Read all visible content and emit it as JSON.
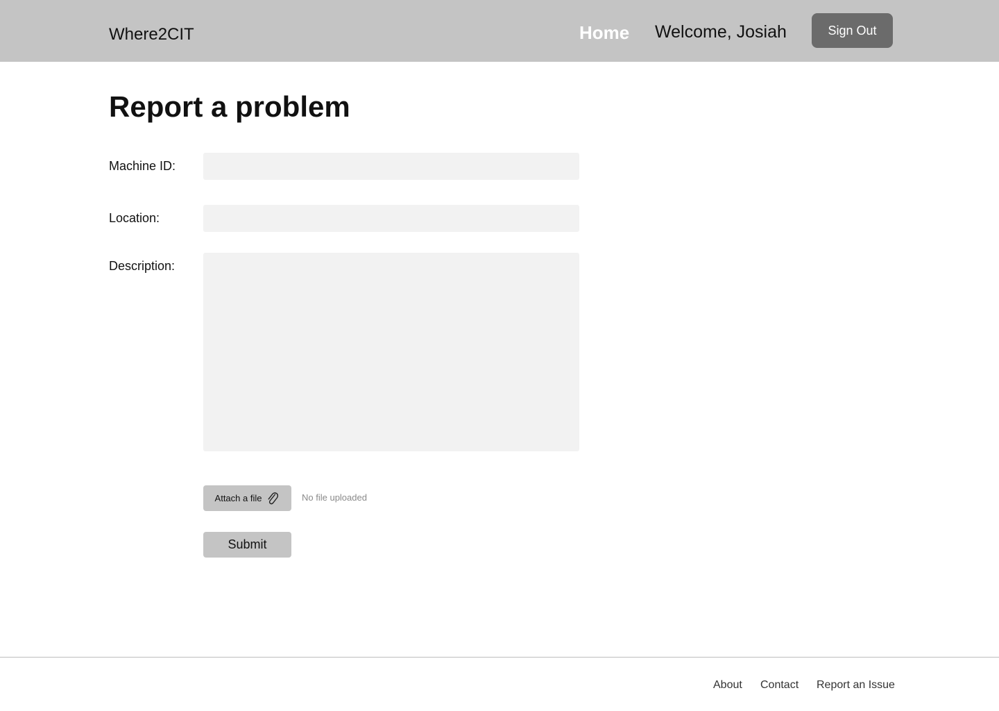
{
  "header": {
    "brand": "Where2CIT",
    "nav_home": "Home",
    "welcome": "Welcome, Josiah",
    "sign_out": "Sign Out"
  },
  "main": {
    "title": "Report a problem",
    "form": {
      "machine_id_label": "Machine ID:",
      "machine_id_value": "",
      "location_label": "Location:",
      "location_value": "",
      "description_label": "Description:",
      "description_value": "",
      "attach_label": "Attach a file",
      "attach_icon": "paperclip-icon",
      "file_status": "No file uploaded",
      "submit_label": "Submit"
    }
  },
  "footer": {
    "links": [
      "About",
      "Contact",
      "Report an Issue"
    ]
  },
  "colors": {
    "header_bg": "#c4c4c4",
    "sign_out_bg": "#6b6b6b",
    "field_bg": "#f2f2f2",
    "button_bg": "#c4c4c4"
  }
}
